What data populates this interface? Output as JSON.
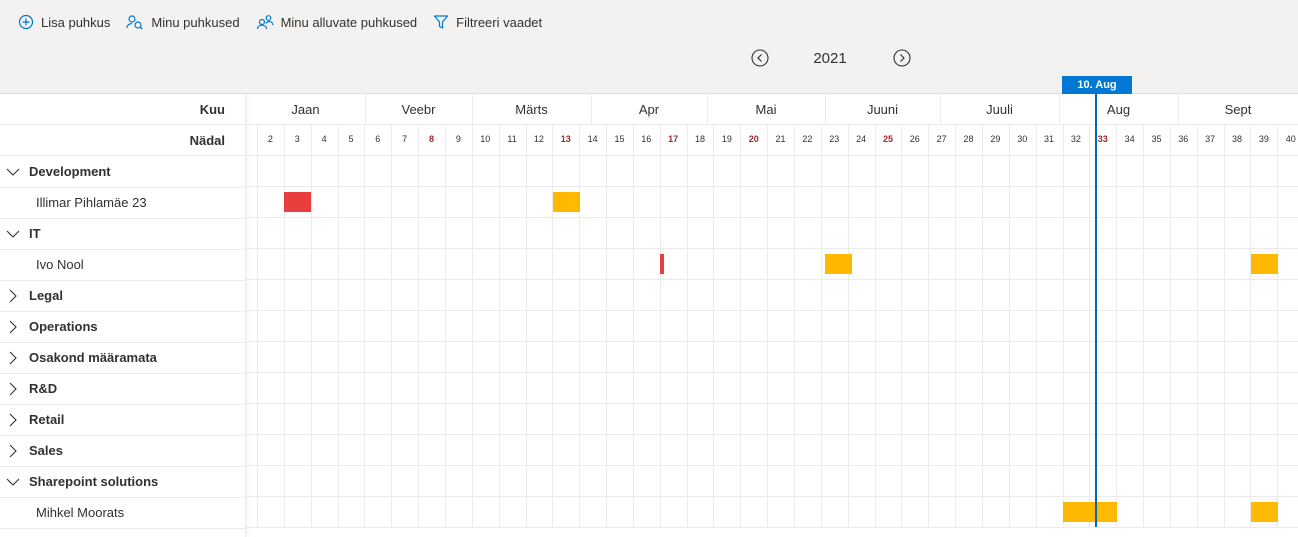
{
  "toolbar": {
    "add_label": "Lisa puhkus",
    "mine_label": "Minu puhkused",
    "subordinates_label": "Minu alluvate puhkused",
    "filter_label": "Filtreeri vaadet"
  },
  "year": {
    "label": "2021"
  },
  "headers": {
    "month": "Kuu",
    "week": "Nädal"
  },
  "today_label": "10. Aug",
  "months": [
    "Jaan",
    "Veebr",
    "Märts",
    "Apr",
    "Mai",
    "Juuni",
    "Juuli",
    "Aug",
    "Sept"
  ],
  "weeks": [
    "2",
    "3",
    "4",
    "5",
    "6",
    "7",
    "8",
    "9",
    "10",
    "11",
    "12",
    "13",
    "14",
    "15",
    "16",
    "17",
    "18",
    "19",
    "20",
    "21",
    "22",
    "23",
    "24",
    "25",
    "26",
    "27",
    "28",
    "29",
    "30",
    "31",
    "32",
    "33",
    "34",
    "35",
    "36",
    "37",
    "38",
    "39",
    "40"
  ],
  "red_weeks": [
    "8",
    "13",
    "17",
    "20",
    "25",
    "33"
  ],
  "rows": [
    {
      "type": "group",
      "label": "Development",
      "expanded": true
    },
    {
      "type": "person",
      "label": "Illimar Pihlamäe 23"
    },
    {
      "type": "group",
      "label": "IT",
      "expanded": true
    },
    {
      "type": "person",
      "label": "Ivo Nool"
    },
    {
      "type": "group",
      "label": "Legal",
      "expanded": false
    },
    {
      "type": "group",
      "label": "Operations",
      "expanded": false
    },
    {
      "type": "group",
      "label": "Osakond määramata",
      "expanded": false
    },
    {
      "type": "group",
      "label": "R&D",
      "expanded": false
    },
    {
      "type": "group",
      "label": "Retail",
      "expanded": false
    },
    {
      "type": "group",
      "label": "Sales",
      "expanded": false
    },
    {
      "type": "group",
      "label": "Sharepoint solutions",
      "expanded": true
    },
    {
      "type": "person",
      "label": "Mihkel Moorats"
    }
  ],
  "colors": {
    "red": "#e83e3e",
    "yellow": "#ffb900",
    "accent": "#0078d4"
  }
}
